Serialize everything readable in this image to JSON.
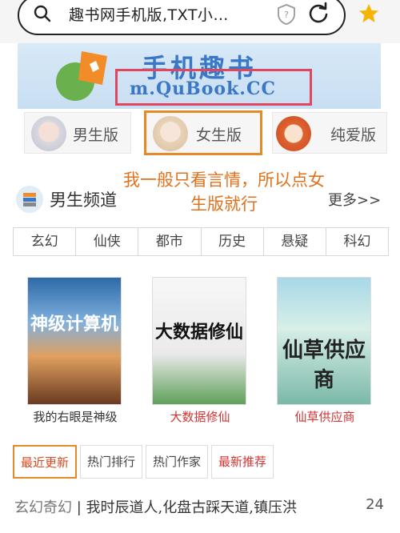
{
  "browser": {
    "url_text": "趣书网手机版,TXT小…",
    "search_icon": "search-icon",
    "shield_icon": "shield-icon",
    "reload_icon": "reload-icon",
    "bookmark_icon": "star-icon"
  },
  "banner": {
    "title": "手机趣书",
    "domain": "m.QuBook.CC"
  },
  "versions": [
    {
      "label": "男生版"
    },
    {
      "label": "女生版"
    },
    {
      "label": "纯爱版"
    }
  ],
  "section": {
    "title": "男生频道",
    "more": "更多>>",
    "note": "我一般只看言情，所以点女生版就行"
  },
  "genres": [
    "玄幻",
    "仙侠",
    "都市",
    "历史",
    "悬疑",
    "科幻"
  ],
  "books": [
    {
      "cover_text": "神级计算机",
      "title": "我的右眼是神级"
    },
    {
      "cover_text": "大数据修仙",
      "title": "大数据修仙"
    },
    {
      "cover_text": "仙草供应商",
      "title": "仙草供应商"
    }
  ],
  "bottom_tabs": [
    "最近更新",
    "热门排行",
    "热门作家",
    "最新推荐"
  ],
  "list": {
    "category": "玄幻奇幻",
    "separator": " | ",
    "title": "我时辰道人,化盘古踩天道,镇压洪",
    "num": "24"
  },
  "colors": {
    "accent_orange": "#e58a28",
    "highlight_red": "#e0465e",
    "brand_blue": "#3a78c7"
  }
}
